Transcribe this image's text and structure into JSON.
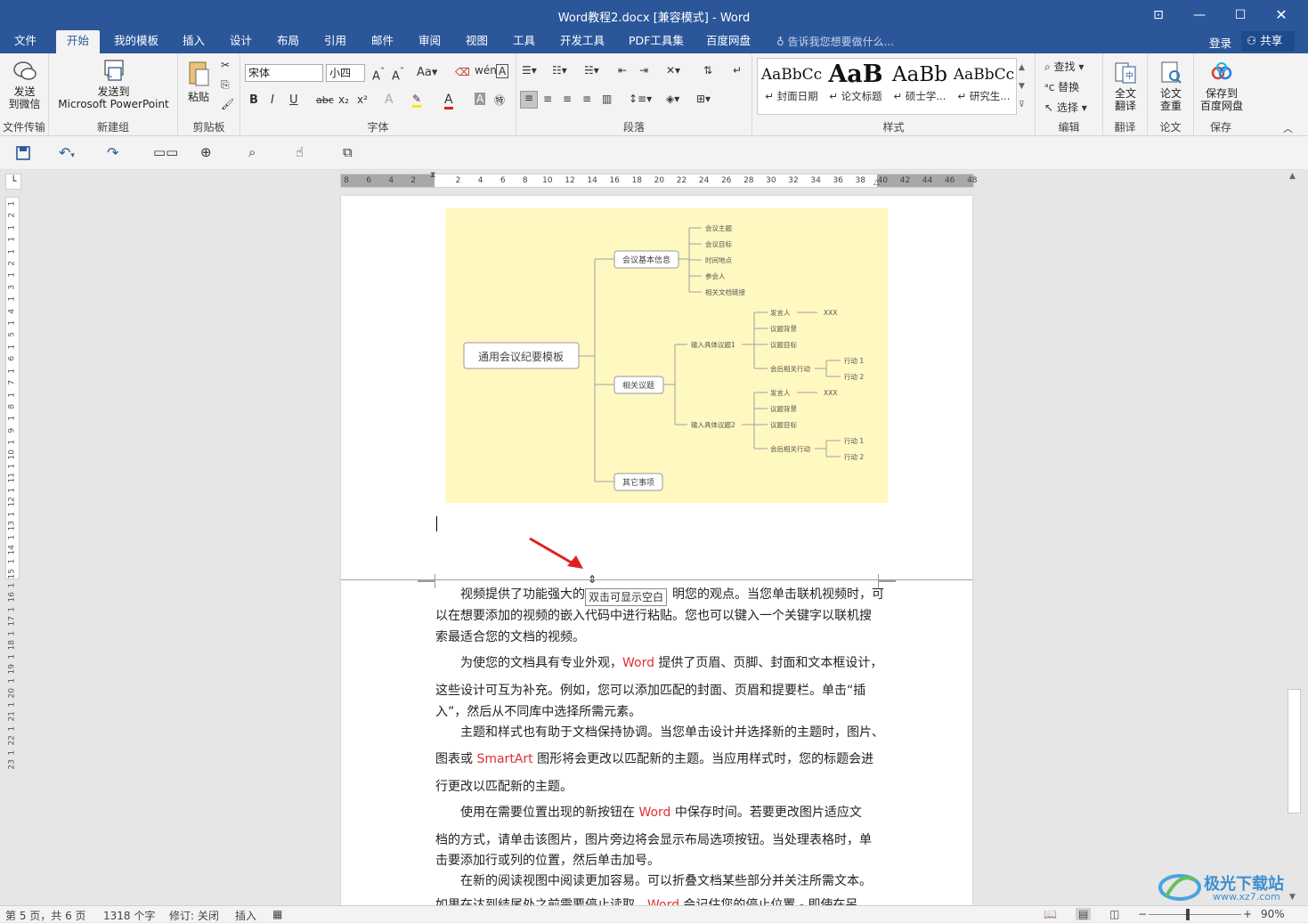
{
  "window": {
    "title": "Word教程2.docx [兼容模式] - Word"
  },
  "tabs": [
    "文件",
    "开始",
    "我的模板",
    "插入",
    "设计",
    "布局",
    "引用",
    "邮件",
    "审阅",
    "视图",
    "工具",
    "开发工具",
    "PDF工具集",
    "百度网盘"
  ],
  "tell_me": "告诉我您想要做什么...",
  "login": "登录",
  "share": "共享",
  "ribbon": {
    "wechat": {
      "label1": "发送",
      "label2": "到微信",
      "group": "文件传输"
    },
    "ppt": {
      "label1": "发送到",
      "label2": "Microsoft PowerPoint",
      "group": "新建组"
    },
    "clipboard": {
      "paste": "粘贴",
      "group": "剪贴板"
    },
    "font": {
      "name": "宋体",
      "size": "小四",
      "group": "字体"
    },
    "paragraph": {
      "group": "段落"
    },
    "styles": {
      "group": "样式",
      "items": [
        {
          "preview": "AaBbCc",
          "name": "↵ 封面日期"
        },
        {
          "preview": "AaB",
          "name": "↵ 论文标题"
        },
        {
          "preview": "AaBb",
          "name": "↵ 硕士学..."
        },
        {
          "preview": "AaBbCc",
          "name": "↵ 研究生..."
        }
      ]
    },
    "edit": {
      "find": "查找",
      "replace": "替换",
      "select": "选择",
      "group": "编辑"
    },
    "translate": {
      "label1": "全文",
      "label2": "翻译",
      "group": "翻译"
    },
    "paper": {
      "label1": "论文",
      "label2": "查重",
      "group": "论文"
    },
    "save": {
      "label1": "保存到",
      "label2": "百度网盘",
      "group": "保存"
    }
  },
  "ruler": {
    "ticks": [
      "8",
      "6",
      "4",
      "2",
      "",
      "2",
      "4",
      "6",
      "8",
      "10",
      "12",
      "14",
      "16",
      "18",
      "20",
      "22",
      "24",
      "26",
      "28",
      "30",
      "32",
      "34",
      "36",
      "38",
      "40",
      "42",
      "44",
      "46",
      "48"
    ]
  },
  "vruler": [
    "1",
    "2",
    "1",
    "1",
    "1",
    "2",
    "1",
    "3",
    "1",
    "4",
    "1",
    "5",
    "1",
    "6",
    "1",
    "7",
    "1",
    "8",
    "1",
    "9",
    "1",
    "10",
    "1",
    "11",
    "1",
    "12",
    "1",
    "13",
    "1",
    "14",
    "1",
    "15",
    "1",
    "16",
    "1",
    "17",
    "1",
    "18",
    "1",
    "19",
    "1",
    "20",
    "1",
    "21",
    "1",
    "22",
    "1",
    "23"
  ],
  "mindmap": {
    "root": "通用会议纪要模板",
    "b1": "会议基本信息",
    "b1_items": [
      "会议主题",
      "会议目标",
      "时间地点",
      "参会人",
      "相关文档链接"
    ],
    "b2": "相关议题",
    "topic1": "输入具体议题1",
    "topic2": "输入具体议题2",
    "t_items": [
      "发言人",
      "议题背景",
      "议题目标",
      "会后相关行动"
    ],
    "xxx": "XXX",
    "actions": [
      "行动 1",
      "行动 2"
    ],
    "b3": "其它事项"
  },
  "tooltip": "双击可显示空白",
  "paragraphs": [
    {
      "lines": [
        [
          "视频提供了功能强大的",
          ""
        ],
        [
          "以在想要添加的视频的嵌入代码中进行粘贴。您也可以键入一个关键字以联机搜",
          ""
        ],
        [
          "索最适合您的文档的视频。",
          ""
        ]
      ]
    },
    {
      "p1": "视频提供了功能强大的",
      "p1b": "方法帮助您证明您的观点。当您单击联机视频时，可"
    }
  ],
  "body": {
    "l1a": "视频提供了功能强大的",
    "l1b": "明您的观点。当您单击联机视频时，可",
    "l2": "以在想要添加的视频的嵌入代码中进行粘贴。您也可以键入一个关键字以联机搜",
    "l3": "索最适合您的文档的视频。",
    "l4a": "为使您的文档具有专业外观，",
    "l4w": "Word",
    "l4b": " 提供了页眉、页脚、封面和文本框设计，",
    "l5": "这些设计可互为补充。例如，您可以添加匹配的封面、页眉和提要栏。单击“插",
    "l6": "入”，然后从不同库中选择所需元素。",
    "l7": "主题和样式也有助于文档保持协调。当您单击设计并选择新的主题时，图片、",
    "l8a": "图表或 ",
    "l8w": "SmartArt",
    "l8b": " 图形将会更改以匹配新的主题。当应用样式时，您的标题会进",
    "l9": "行更改以匹配新的主题。",
    "l10a": "使用在需要位置出现的新按钮在 ",
    "l10w": "Word",
    "l10b": " 中保存时间。若要更改图片适应文",
    "l11": "档的方式，请单击该图片，图片旁边将会显示布局选项按钮。当处理表格时，单",
    "l12": "击要添加行或列的位置，然后单击加号。",
    "l13": "在新的阅读视图中阅读更加容易。可以折叠文档某些部分并关注所需文本。",
    "l14a": "如果在达到结尾处之前需要停止读取，",
    "l14w": "Word",
    "l14b": " 会记住您的停止位置 - 即使在另"
  },
  "status": {
    "page": "第 5 页，共 6 页",
    "words": "1318 个字",
    "track": "修订: 关闭",
    "mode": "插入",
    "zoom": "90%"
  },
  "watermark": {
    "text": "极光下载站",
    "url": "www.xz7.com"
  },
  "colors": {
    "titlebar": "#2b579a",
    "accent_red": "#e03030",
    "mindmap_bg": "#fff8c0"
  }
}
